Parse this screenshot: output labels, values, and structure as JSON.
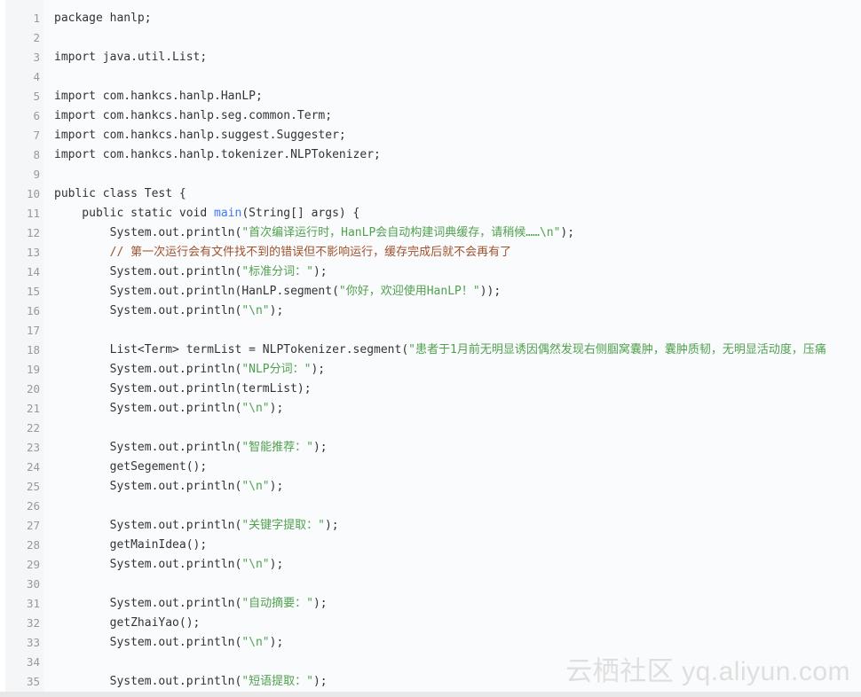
{
  "code": {
    "lines": [
      {
        "n": "1",
        "segs": [
          {
            "t": "package hanlp;",
            "c": "plain"
          }
        ]
      },
      {
        "n": "2",
        "segs": []
      },
      {
        "n": "3",
        "segs": [
          {
            "t": "import java.util.List;",
            "c": "plain"
          }
        ]
      },
      {
        "n": "4",
        "segs": []
      },
      {
        "n": "5",
        "segs": [
          {
            "t": "import com.hankcs.hanlp.HanLP;",
            "c": "plain"
          }
        ]
      },
      {
        "n": "6",
        "segs": [
          {
            "t": "import com.hankcs.hanlp.seg.common.Term;",
            "c": "plain"
          }
        ]
      },
      {
        "n": "7",
        "segs": [
          {
            "t": "import com.hankcs.hanlp.suggest.Suggester;",
            "c": "plain"
          }
        ]
      },
      {
        "n": "8",
        "segs": [
          {
            "t": "import com.hankcs.hanlp.tokenizer.NLPTokenizer;",
            "c": "plain"
          }
        ]
      },
      {
        "n": "9",
        "segs": []
      },
      {
        "n": "10",
        "segs": [
          {
            "t": "public class Test {",
            "c": "plain"
          }
        ]
      },
      {
        "n": "11",
        "segs": [
          {
            "t": "    public static void ",
            "c": "plain"
          },
          {
            "t": "main",
            "c": "fn"
          },
          {
            "t": "(String[] args) {",
            "c": "plain"
          }
        ]
      },
      {
        "n": "12",
        "segs": [
          {
            "t": "        System.out.println(",
            "c": "plain"
          },
          {
            "t": "\"首次编译运行时，HanLP会自动构建词典缓存，请稍候……\\n\"",
            "c": "str"
          },
          {
            "t": ");",
            "c": "plain"
          }
        ]
      },
      {
        "n": "13",
        "segs": [
          {
            "t": "        // 第一次运行会有文件找不到的错误但不影响运行，缓存完成后就不会再有了",
            "c": "com"
          }
        ]
      },
      {
        "n": "14",
        "segs": [
          {
            "t": "        System.out.println(",
            "c": "plain"
          },
          {
            "t": "\"标准分词：\"",
            "c": "str"
          },
          {
            "t": ");",
            "c": "plain"
          }
        ]
      },
      {
        "n": "15",
        "segs": [
          {
            "t": "        System.out.println(HanLP.segment(",
            "c": "plain"
          },
          {
            "t": "\"你好，欢迎使用HanLP！\"",
            "c": "str"
          },
          {
            "t": "));",
            "c": "plain"
          }
        ]
      },
      {
        "n": "16",
        "segs": [
          {
            "t": "        System.out.println(",
            "c": "plain"
          },
          {
            "t": "\"\\n\"",
            "c": "str"
          },
          {
            "t": ");",
            "c": "plain"
          }
        ]
      },
      {
        "n": "17",
        "segs": []
      },
      {
        "n": "18",
        "segs": [
          {
            "t": "        List<Term> termList = NLPTokenizer.segment(",
            "c": "plain"
          },
          {
            "t": "\"患者于1月前无明显诱因偶然发现右侧腘窝囊肿，囊肿质韧，无明显活动度，压痛",
            "c": "str"
          }
        ]
      },
      {
        "n": "19",
        "segs": [
          {
            "t": "        System.out.println(",
            "c": "plain"
          },
          {
            "t": "\"NLP分词：\"",
            "c": "str"
          },
          {
            "t": ");",
            "c": "plain"
          }
        ]
      },
      {
        "n": "20",
        "segs": [
          {
            "t": "        System.out.println(termList);",
            "c": "plain"
          }
        ]
      },
      {
        "n": "21",
        "segs": [
          {
            "t": "        System.out.println(",
            "c": "plain"
          },
          {
            "t": "\"\\n\"",
            "c": "str"
          },
          {
            "t": ");",
            "c": "plain"
          }
        ]
      },
      {
        "n": "22",
        "segs": []
      },
      {
        "n": "23",
        "segs": [
          {
            "t": "        System.out.println(",
            "c": "plain"
          },
          {
            "t": "\"智能推荐：\"",
            "c": "str"
          },
          {
            "t": ");",
            "c": "plain"
          }
        ]
      },
      {
        "n": "24",
        "segs": [
          {
            "t": "        getSegement();",
            "c": "plain"
          }
        ]
      },
      {
        "n": "25",
        "segs": [
          {
            "t": "        System.out.println(",
            "c": "plain"
          },
          {
            "t": "\"\\n\"",
            "c": "str"
          },
          {
            "t": ");",
            "c": "plain"
          }
        ]
      },
      {
        "n": "26",
        "segs": []
      },
      {
        "n": "27",
        "segs": [
          {
            "t": "        System.out.println(",
            "c": "plain"
          },
          {
            "t": "\"关键字提取：\"",
            "c": "str"
          },
          {
            "t": ");",
            "c": "plain"
          }
        ]
      },
      {
        "n": "28",
        "segs": [
          {
            "t": "        getMainIdea();",
            "c": "plain"
          }
        ]
      },
      {
        "n": "29",
        "segs": [
          {
            "t": "        System.out.println(",
            "c": "plain"
          },
          {
            "t": "\"\\n\"",
            "c": "str"
          },
          {
            "t": ");",
            "c": "plain"
          }
        ]
      },
      {
        "n": "30",
        "segs": []
      },
      {
        "n": "31",
        "segs": [
          {
            "t": "        System.out.println(",
            "c": "plain"
          },
          {
            "t": "\"自动摘要：\"",
            "c": "str"
          },
          {
            "t": ");",
            "c": "plain"
          }
        ]
      },
      {
        "n": "32",
        "segs": [
          {
            "t": "        getZhaiYao();",
            "c": "plain"
          }
        ]
      },
      {
        "n": "33",
        "segs": [
          {
            "t": "        System.out.println(",
            "c": "plain"
          },
          {
            "t": "\"\\n\"",
            "c": "str"
          },
          {
            "t": ");",
            "c": "plain"
          }
        ]
      },
      {
        "n": "34",
        "segs": []
      },
      {
        "n": "35",
        "segs": [
          {
            "t": "        System.out.println(",
            "c": "plain"
          },
          {
            "t": "\"短语提取：\"",
            "c": "str"
          },
          {
            "t": ");",
            "c": "plain"
          }
        ]
      }
    ]
  },
  "watermark": {
    "text": "云栖社区 yq.aliyun.com"
  },
  "colors": {
    "string": "#50a14f",
    "comment": "#a0522d",
    "function": "#4078f2",
    "plain": "#333333",
    "line_number": "#999999",
    "background": "#fafbfc"
  }
}
